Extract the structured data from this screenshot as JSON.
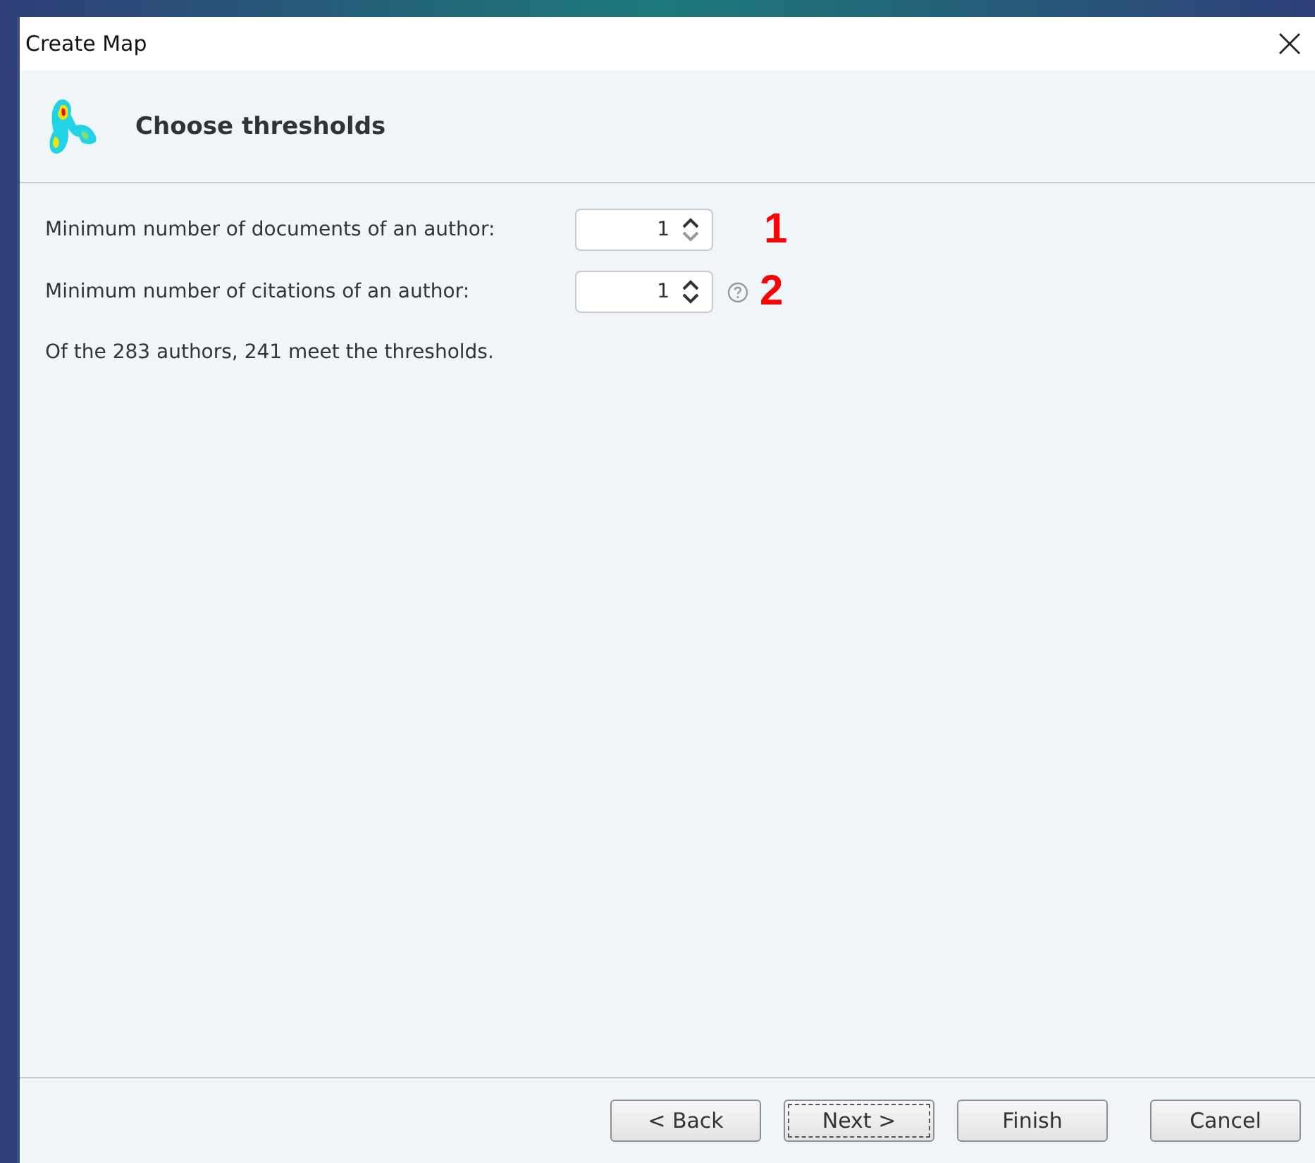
{
  "window": {
    "title": "Create Map"
  },
  "header": {
    "title": "Choose thresholds"
  },
  "fields": [
    {
      "label": "Minimum number of documents of an author:",
      "value": "1",
      "down_disabled": true,
      "help": false,
      "annotation": "1"
    },
    {
      "label": "Minimum number of citations of an author:",
      "value": "1",
      "down_disabled": false,
      "help": true,
      "annotation": "2"
    }
  ],
  "summary": "Of the 283 authors, 241 meet the thresholds.",
  "buttons": [
    {
      "label": "< Back",
      "focused": false
    },
    {
      "label": "Next >",
      "focused": true
    },
    {
      "label": "Finish",
      "focused": false
    },
    {
      "label": "Cancel",
      "focused": false
    }
  ]
}
